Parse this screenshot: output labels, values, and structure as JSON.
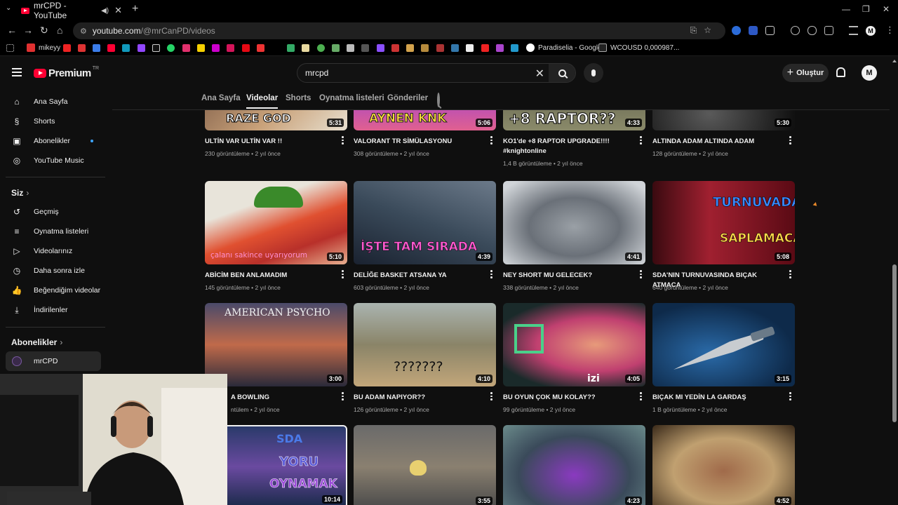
{
  "browser": {
    "tab_title": "mrCPD - YouTube",
    "url_host": "youtube.com",
    "url_path": "/@mrCanPD/videos",
    "profile_initial": "M",
    "bookmarks": [
      "mikeyy",
      "Paradiselia - Google...",
      "WCOUSD 0,000987..."
    ]
  },
  "masthead": {
    "logo_text": "Premium",
    "logo_region": "TR",
    "search_value": "mrcpd",
    "create_label": "Oluştur",
    "avatar_initial": "M"
  },
  "sidebar": {
    "main": [
      {
        "label": "Ana Sayfa",
        "icon": "home-icon"
      },
      {
        "label": "Shorts",
        "icon": "shorts-icon"
      },
      {
        "label": "Abonelikler",
        "icon": "subscriptions-icon"
      },
      {
        "label": "YouTube Music",
        "icon": "music-icon"
      }
    ],
    "you_header": "Siz",
    "you": [
      {
        "label": "Geçmiş",
        "icon": "history-icon"
      },
      {
        "label": "Oynatma listeleri",
        "icon": "playlists-icon"
      },
      {
        "label": "Videolarınız",
        "icon": "your-videos-icon"
      },
      {
        "label": "Daha sonra izle",
        "icon": "watch-later-icon"
      },
      {
        "label": "Beğendiğim videolar",
        "icon": "liked-icon"
      },
      {
        "label": "İndirilenler",
        "icon": "downloads-icon"
      }
    ],
    "subs_header": "Abonelikler",
    "subs": [
      {
        "label": "mrCPD"
      }
    ]
  },
  "channel_tabs": [
    "Ana Sayfa",
    "Videolar",
    "Shorts",
    "Oynatma listeleri",
    "Gönderiler"
  ],
  "active_tab": "Videolar",
  "videos": [
    {
      "title": "ULTİN VAR ULTİN VAR !!",
      "views": "230 görüntüleme",
      "age": "2 yıl önce",
      "duration": "5:31"
    },
    {
      "title": "VALORANT TR SİMÜLASYONU",
      "views": "308 görüntüleme",
      "age": "2 yıl önce",
      "duration": "5:06"
    },
    {
      "title": "KO1'de +8 RAPTOR UPGRADE!!!! #knightonline",
      "views": "1,4 B görüntüleme",
      "age": "2 yıl önce",
      "duration": "4:33"
    },
    {
      "title": "ALTINDA ADAM ALTINDA ADAM",
      "views": "128 görüntüleme",
      "age": "2 yıl önce",
      "duration": "5:30"
    },
    {
      "title": "ABİCİM BEN ANLAMADIM",
      "views": "145 görüntüleme",
      "age": "2 yıl önce",
      "duration": "5:10"
    },
    {
      "title": "DELİĞE BASKET ATSANA YA",
      "views": "603 görüntüleme",
      "age": "2 yıl önce",
      "duration": "4:39"
    },
    {
      "title": "NEY SHORT MU GELECEK?",
      "views": "338 görüntüleme",
      "age": "2 yıl önce",
      "duration": "4:41"
    },
    {
      "title": "SDA'NIN TURNUVASINDA BIÇAK ATMACA",
      "views": "640 görüntüleme",
      "age": "2 yıl önce",
      "duration": "5:08"
    },
    {
      "title": "A BOWLING",
      "views": "ntülem",
      "age": "2 yıl önce",
      "duration": "3:00"
    },
    {
      "title": "BU ADAM NAPIYOR??",
      "views": "126 görüntüleme",
      "age": "2 yıl önce",
      "duration": "4:10"
    },
    {
      "title": "BU OYUN ÇOK MU KOLAY??",
      "views": "99 görüntüleme",
      "age": "2 yıl önce",
      "duration": "4:05"
    },
    {
      "title": "BIÇAK MI YEDİN LA GARDAŞ",
      "views": "1 B görüntüleme",
      "age": "2 yıl önce",
      "duration": "3:15"
    },
    {
      "title": "",
      "views": "",
      "age": "",
      "duration": "10:14"
    },
    {
      "title": "",
      "views": "",
      "age": "",
      "duration": "3:55"
    },
    {
      "title": "",
      "views": "",
      "age": "",
      "duration": "4:23"
    },
    {
      "title": "",
      "views": "",
      "age": "",
      "duration": "4:52"
    }
  ],
  "thumb_texts": {
    "t0": "RAZE GOD",
    "t1": "AYNEN KNK",
    "t2": "+8 RAPTOR??",
    "t4": "çalanı sakince uyarıyorum",
    "t5": "İŞTE TAM SIRADA",
    "t7a": "TURNUVADA",
    "t7b": "SAPLAMACA",
    "t8": "AMERICAN PSYCHO",
    "t9": "???????",
    "t10": "izi",
    "t12a": "SDA",
    "t12b": "YORU",
    "t12c": "OYNAMAK"
  }
}
